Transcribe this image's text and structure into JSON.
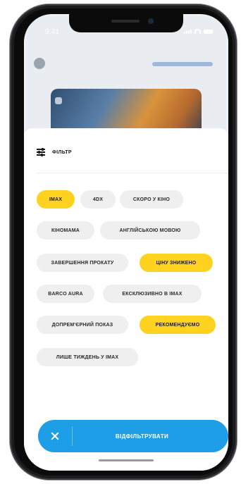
{
  "status_bar": {
    "time": "9:41"
  },
  "filter": {
    "title": "ФІЛЬТР",
    "chips": [
      {
        "label": "IMAX",
        "active": true
      },
      {
        "label": "4DX",
        "active": false
      },
      {
        "label": "СКОРО У КІНО",
        "active": false
      },
      {
        "label": "КІНОМАМА",
        "active": false
      },
      {
        "label": "АНГЛІЙСЬКОЮ МОВОЮ",
        "active": false
      },
      {
        "label": "ЗАВЕРШЕННЯ ПРОКАТУ",
        "active": false
      },
      {
        "label": "ЦІНУ ЗНИЖЕНО",
        "active": true
      },
      {
        "label": "BARCO AURA",
        "active": false
      },
      {
        "label": "ЕКСКЛЮЗИВНО В IMAX",
        "active": false
      },
      {
        "label": "ДОПРЕМ'ЄРНИЙ ПОКАЗ",
        "active": false
      },
      {
        "label": "РЕКОМЕНДУЄМО",
        "active": true
      },
      {
        "label": "ЛИШЕ ТИЖДЕНЬ У IMAX",
        "active": false
      }
    ]
  },
  "apply_button": {
    "label": "ВІДФІЛЬТРУВАТИ"
  },
  "colors": {
    "accent_blue": "#1e9ee6",
    "chip_active": "#ffd21f",
    "chip_inactive": "#efefef"
  },
  "icons": [
    "filter-sliders-icon",
    "close-icon",
    "signal-icon",
    "wifi-icon",
    "battery-icon"
  ]
}
